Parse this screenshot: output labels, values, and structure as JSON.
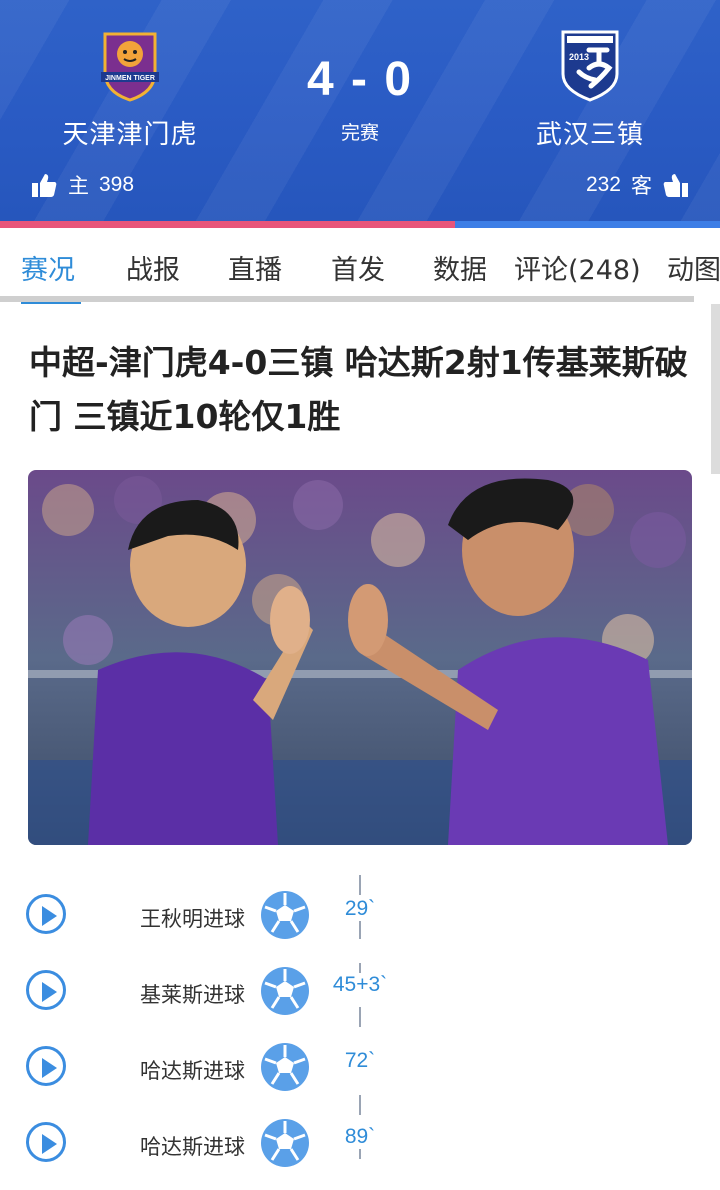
{
  "match": {
    "home_team": "天津津门虎",
    "away_team": "武汉三镇",
    "score": "4 - 0",
    "status": "完赛",
    "home_likes": {
      "label": "主",
      "count": "398"
    },
    "away_likes": {
      "label": "客",
      "count": "232"
    },
    "home_like_share": 0.632,
    "home_logo_text": "JINMEN TIGER",
    "away_logo_text": "2013"
  },
  "tabs": [
    {
      "label": "赛况",
      "active": true
    },
    {
      "label": "战报"
    },
    {
      "label": "直播"
    },
    {
      "label": "首发"
    },
    {
      "label": "数据"
    },
    {
      "label": "评论(248)"
    },
    {
      "label": "动图"
    }
  ],
  "article": {
    "headline": "中超-津门虎4-0三镇 哈达斯2射1传基莱斯破门 三镇近10轮仅1胜",
    "photo_icon": "match-photo"
  },
  "events": [
    {
      "label": "王秋明进球",
      "minute": "29`",
      "icon": "soccer-ball-icon"
    },
    {
      "label": "基莱斯进球",
      "minute": "45+3`",
      "icon": "soccer-ball-icon"
    },
    {
      "label": "哈达斯进球",
      "minute": "72`",
      "icon": "soccer-ball-icon"
    },
    {
      "label": "哈达斯进球",
      "minute": "89`",
      "icon": "soccer-ball-icon"
    }
  ],
  "colors": {
    "header_blue": "#2a5bc4",
    "accent_blue": "#2f8cd8",
    "home_bar": "#e8557a",
    "away_bar": "#3d7ee6"
  }
}
